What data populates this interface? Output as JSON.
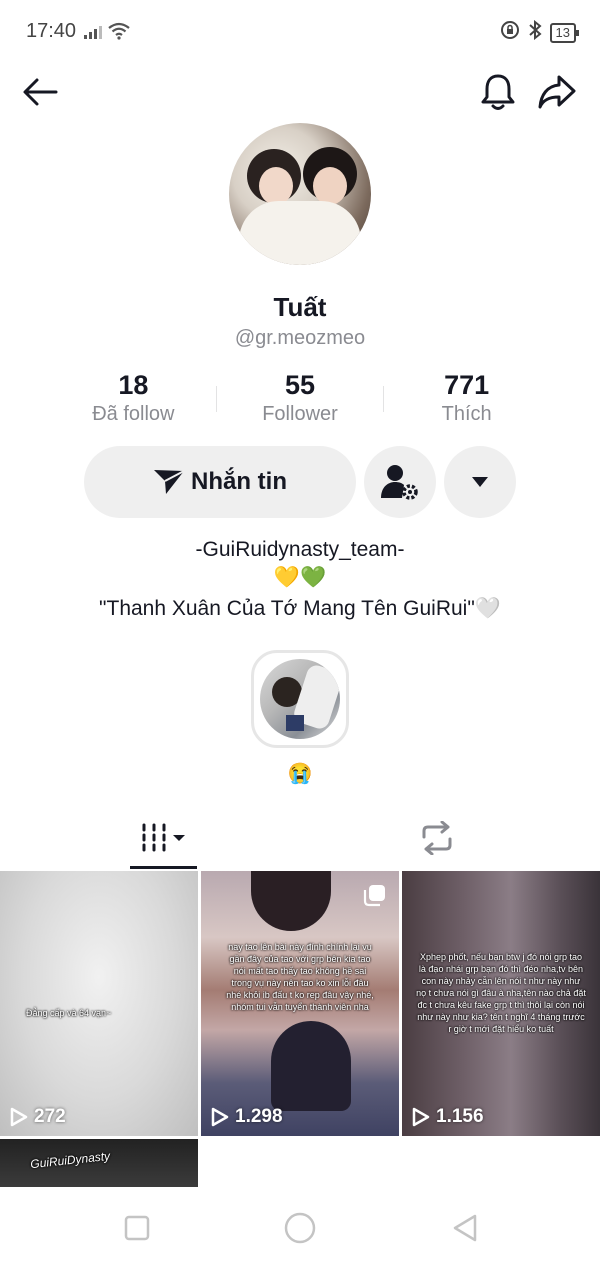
{
  "status_bar": {
    "time": "17:40",
    "battery": "13"
  },
  "profile": {
    "display_name": "Tuất",
    "username": "@gr.meozmeo",
    "stats": [
      {
        "value": "18",
        "label": "Đã follow"
      },
      {
        "value": "55",
        "label": "Follower"
      },
      {
        "value": "771",
        "label": "Thích"
      }
    ],
    "message_button": "Nhắn tin",
    "bio_line1": "-GuiRuidynasty_team-",
    "bio_line2": "💛💚",
    "bio_line3": "\"Thanh Xuân Của Tớ Mang Tên GuiRui\"🤍",
    "highlight_label": "😭"
  },
  "videos": [
    {
      "caption": "Đẳng cấp và 64 vạn~",
      "views": "272"
    },
    {
      "caption": "nay tao lên bài này đính chính lại vụ gần đây của tao với grp bên kia tao nói mất tao thấy tao không hề sai trong vụ này nên tao ko xin lỗi đâu nhé khỏi ib đấu t ko rep đâu vậy nhé, nhóm tui vẫn tuyển thành viên nha",
      "views": "1.298"
    },
    {
      "caption": "Xphep phốt, nếu bạn btw j đó nói grp tao là đạo nhái grp bạn đó thì đéo nha,tv bên con này nhảy cẫn lên nói t như này như nọ t chưa nói gì đâu à nha,tên nào chả đặt đc t chưa kêu fake grp t thì thôi lại còn nói như này như kia? tên t nghĩ 4 tháng trước r giờ t mới đặt hiểu ko tuất",
      "views": "1.156"
    },
    {
      "caption": "GuiRuiDynasty",
      "views": ""
    }
  ]
}
